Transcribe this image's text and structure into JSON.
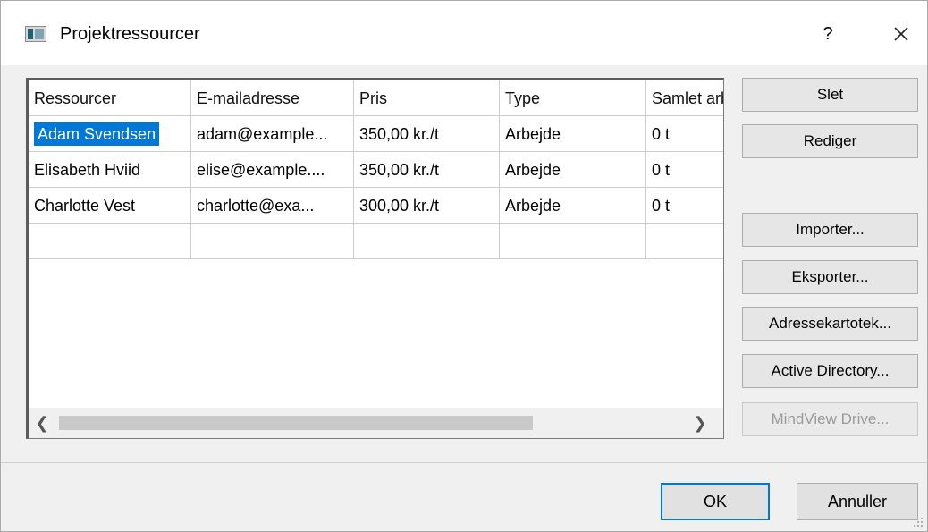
{
  "window": {
    "title": "Projektressourcer",
    "help_label": "?",
    "close_icon": "close-icon",
    "app_icon": "resource-grid-icon"
  },
  "grid": {
    "columns": [
      "Ressourcer",
      "E-mailadresse",
      "Pris",
      "Type",
      "Samlet arbejde"
    ],
    "rows": [
      [
        "Adam Svendsen",
        "adam@example...",
        "350,00 kr./t",
        "Arbejde",
        "0 t"
      ],
      [
        "Elisabeth Hviid",
        "elise@example....",
        "350,00 kr./t",
        "Arbejde",
        "0 t"
      ],
      [
        "Charlotte Vest",
        "charlotte@exa...",
        "300,00 kr./t",
        "Arbejde",
        "0 t"
      ],
      [
        "",
        "",
        "",
        "",
        ""
      ]
    ],
    "selected_row": 0,
    "scroll_left_icon": "chevron-left-icon",
    "scroll_right_icon": "chevron-right-icon"
  },
  "side_buttons": {
    "delete": "Slet",
    "edit": "Rediger",
    "import": "Importer...",
    "export": "Eksporter...",
    "address_book": "Adressekartotek...",
    "active_directory": "Active Directory...",
    "mindview_drive": "MindView Drive..."
  },
  "footer": {
    "ok": "OK",
    "cancel": "Annuller"
  },
  "colors": {
    "selection": "#0078d7",
    "dialog_bg": "#f0f0f0",
    "default_button_border": "#0078d7"
  }
}
